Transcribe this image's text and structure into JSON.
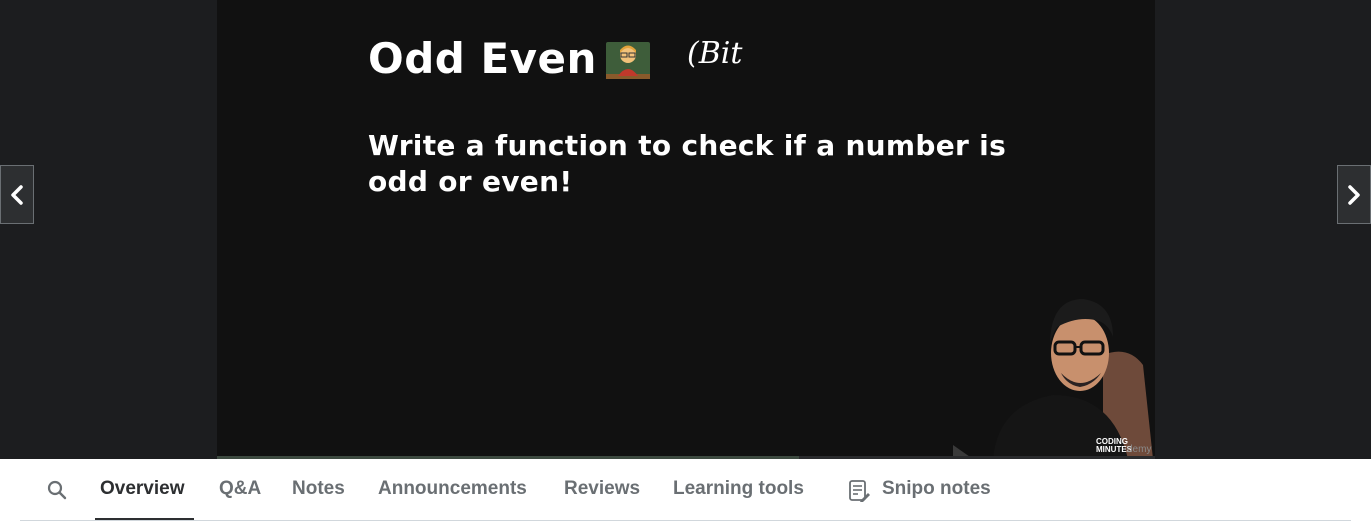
{
  "slide": {
    "title": "Odd Even",
    "handwritten_note": "(Bit",
    "question": "Write a function to check if a number is odd or even!",
    "title_emoji": "teacher-emoji"
  },
  "presenter": {
    "shirt_logo_line1": "CODING",
    "shirt_logo_line2": "MINUTES",
    "watermark": "demy"
  },
  "video": {
    "progress_fraction": 0.62
  },
  "navigation": {
    "prev_icon": "chevron-left-icon",
    "next_icon": "chevron-right-icon"
  },
  "tabs": {
    "search_icon": "search-icon",
    "items": [
      {
        "label": "Overview",
        "active": true
      },
      {
        "label": "Q&A",
        "active": false
      },
      {
        "label": "Notes",
        "active": false
      },
      {
        "label": "Announcements",
        "active": false
      },
      {
        "label": "Reviews",
        "active": false
      },
      {
        "label": "Learning tools",
        "active": false
      },
      {
        "label": "Snipo notes",
        "active": false,
        "icon": "notes-icon"
      }
    ]
  },
  "colors": {
    "background": "#1c1d1f",
    "slide": "#111111",
    "tab_active": "#2d2f31",
    "tab_inactive": "#6a6f73"
  }
}
